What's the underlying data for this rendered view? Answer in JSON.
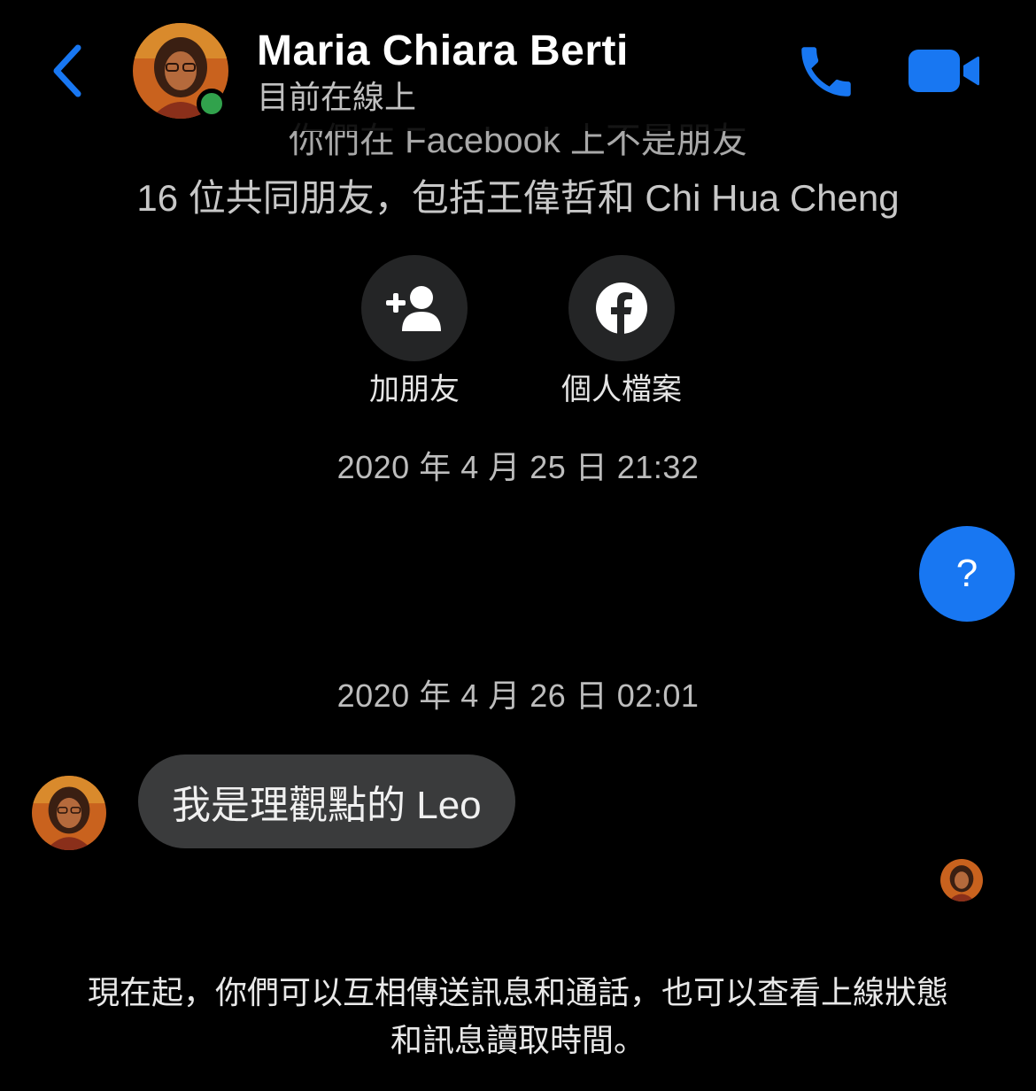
{
  "header": {
    "name": "Maria Chiara Berti",
    "status": "目前在線上",
    "accent_color": "#1877f2",
    "icons": [
      "back-chevron-icon",
      "phone-icon",
      "video-camera-icon"
    ]
  },
  "intro": {
    "line1": "你們在 Facebook 上不是朋友",
    "line2": "16 位共同朋友，包括王偉哲和 Chi Hua Cheng"
  },
  "actions": [
    {
      "label": "加朋友",
      "icon": "add-friend-icon"
    },
    {
      "label": "個人檔案",
      "icon": "facebook-logo-icon"
    }
  ],
  "messages": [
    {
      "timestamp": "2020 年 4 月 25 日 21:32",
      "direction": "outgoing",
      "text": "?"
    },
    {
      "timestamp": "2020 年 4 月 26 日 02:01",
      "direction": "incoming",
      "text": "我是理觀點的 Leo"
    }
  ],
  "footer": {
    "line1": "現在起，你們可以互相傳送訊息和通話，也可以查看上線狀態",
    "line2": "和訊息讀取時間。"
  }
}
